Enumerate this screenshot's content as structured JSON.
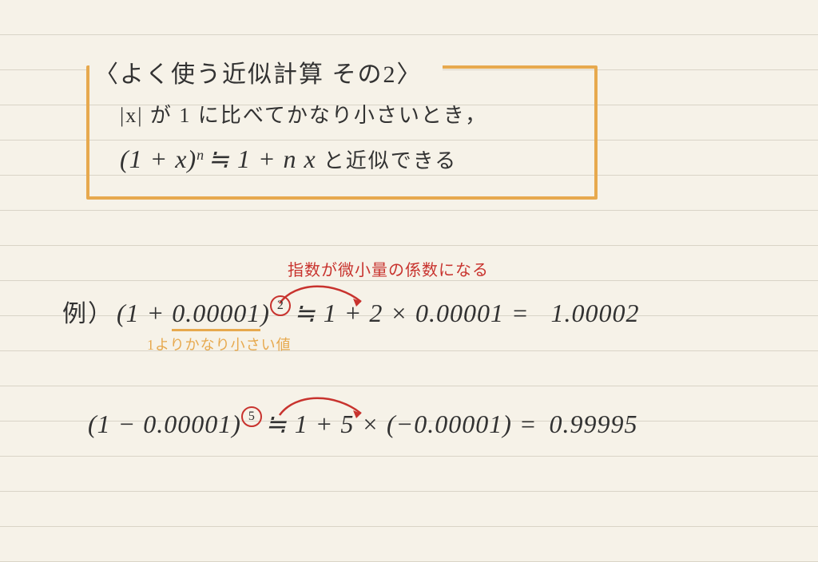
{
  "title": "〈よく使う近似計算 その2〉",
  "rule_line1": "|x| が 1 に比べてかなり小さいとき，",
  "rule_line2_left": "(1 + x)",
  "rule_line2_exp": "n",
  "rule_line2_mid": " ≒ 1 + n x ",
  "rule_line2_right": "と近似できる",
  "red_note_top": "指数が微小量の係数になる",
  "example_label": "例）",
  "ex1_left": "(1 + ",
  "ex1_small": "0.00001",
  "ex1_close": ")",
  "ex1_exp": "2",
  "ex1_mid": " ≒ 1 + 2 × 0.00001 = ",
  "ex1_result": "1.00002",
  "orange_note": "1よりかなり小さい値",
  "ex2_left": "(1 − 0.00001)",
  "ex2_exp": "5",
  "ex2_mid": " ≒ 1 + 5 × (−0.00001) = ",
  "ex2_result": "0.99995"
}
